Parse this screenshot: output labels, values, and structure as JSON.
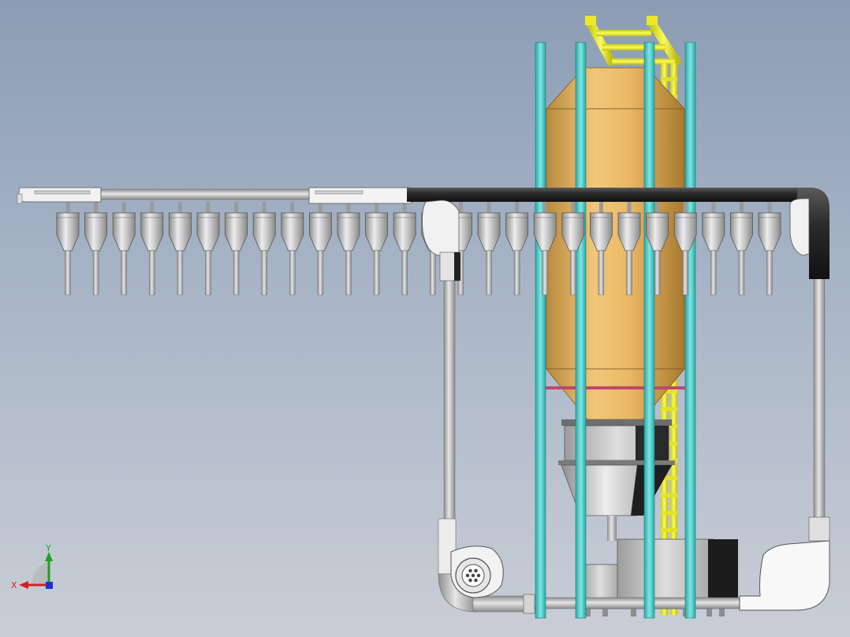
{
  "viewport": {
    "background_top": "#8b9db5",
    "background_bottom": "#c9ced6"
  },
  "colors": {
    "silo_body": "#e7b563",
    "support_column": "#54d0cc",
    "ladder": "#eeee2e",
    "pipe": "#b9b9b9",
    "dark_duct": "#2f2f2f",
    "flange": "#c0476e"
  },
  "triad": {
    "x_label": "X",
    "y_label": "Y",
    "x_color": "#d62020",
    "y_color": "#1ea11e",
    "z_color": "#2030d0"
  },
  "cyclone_count": 26
}
